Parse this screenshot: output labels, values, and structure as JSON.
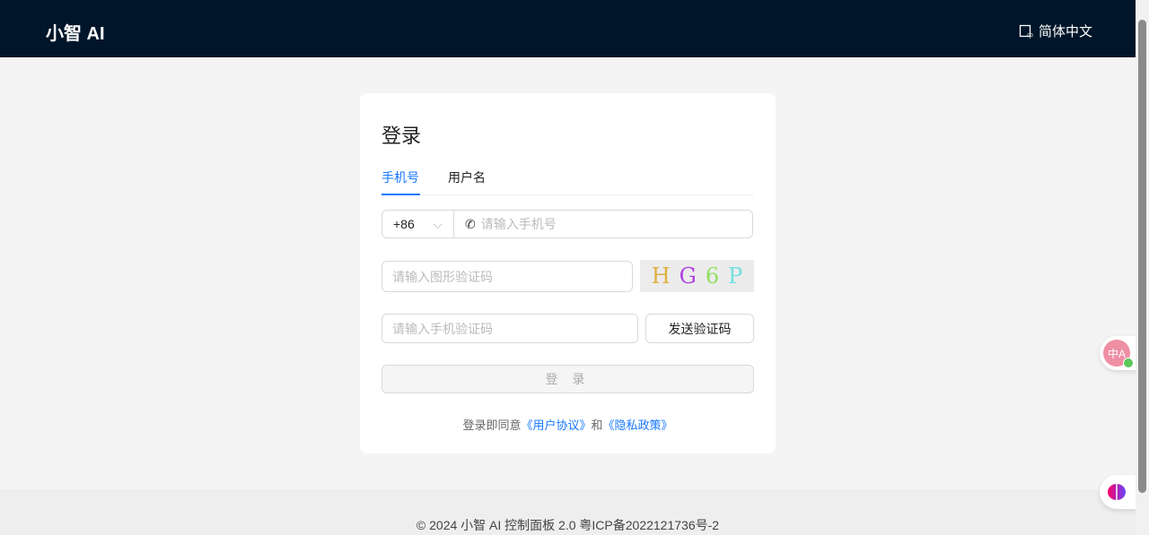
{
  "header": {
    "logo": "小智 AI",
    "language": "简体中文"
  },
  "login": {
    "title": "登录",
    "tabs": [
      "手机号",
      "用户名"
    ],
    "country_code": "+86",
    "phone_placeholder": "请输入手机号",
    "captcha_placeholder": "请输入图形验证码",
    "captcha_chars": [
      "H",
      "G",
      "6",
      "P"
    ],
    "sms_placeholder": "请输入手机验证码",
    "send_code": "发送验证码",
    "submit": "登 录",
    "agree_prefix": "登录即同意",
    "user_agreement": "《用户协议》",
    "and": "和",
    "privacy_policy": "《隐私政策》"
  },
  "footer": {
    "text": "© 2024 小智 AI 控制面板 2.0 粤ICP备2022121736号-2"
  },
  "floating": {
    "translate_icon_text": "中A"
  }
}
